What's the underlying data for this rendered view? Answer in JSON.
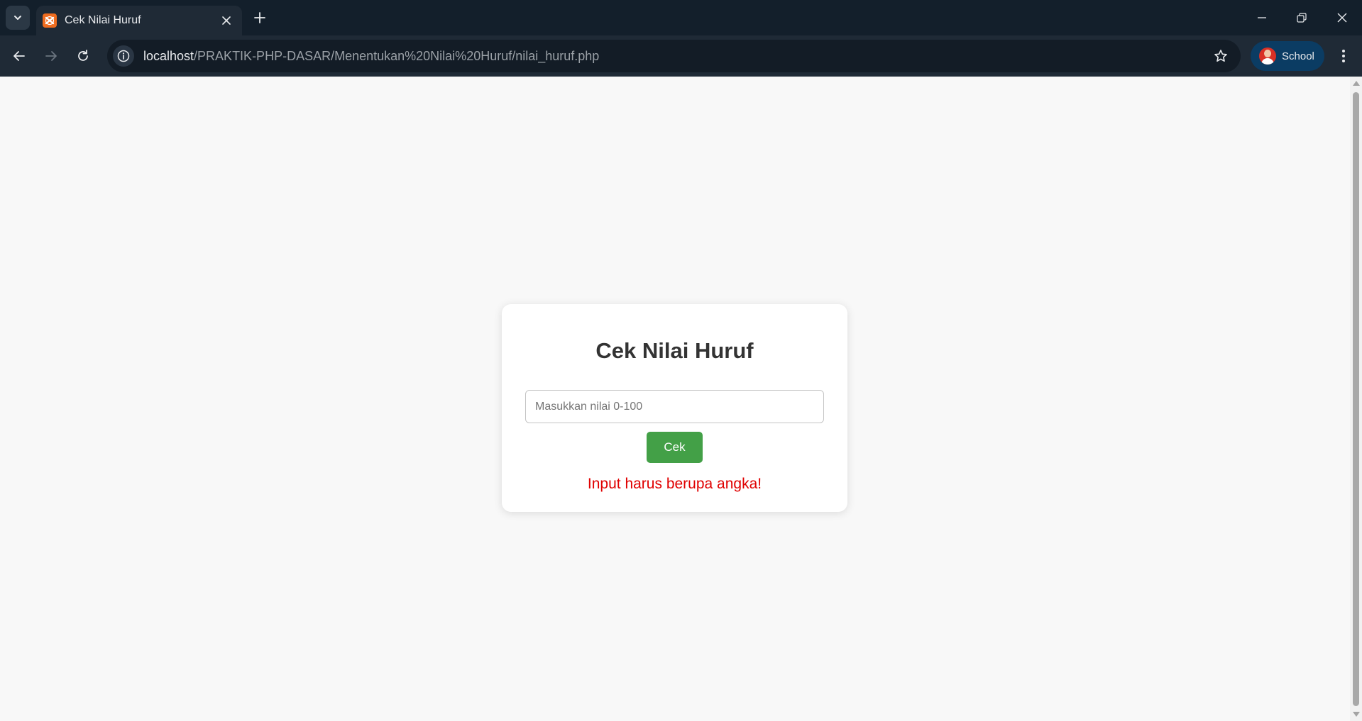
{
  "browser": {
    "tab_title": "Cek Nilai Huruf",
    "url_host": "localhost",
    "url_path": "/PRAKTIK-PHP-DASAR/Menentukan%20Nilai%20Huruf/nilai_huruf.php",
    "profile_label": "School",
    "profile_color": "#0b3c63",
    "favicon_color": "#ef6c1f"
  },
  "page": {
    "title": "Cek Nilai Huruf",
    "input_placeholder": "Masukkan nilai 0-100",
    "input_value": "",
    "button_label": "Cek",
    "error_message": "Input harus berupa angka!",
    "button_color": "#43a047",
    "error_color": "#e00000"
  }
}
